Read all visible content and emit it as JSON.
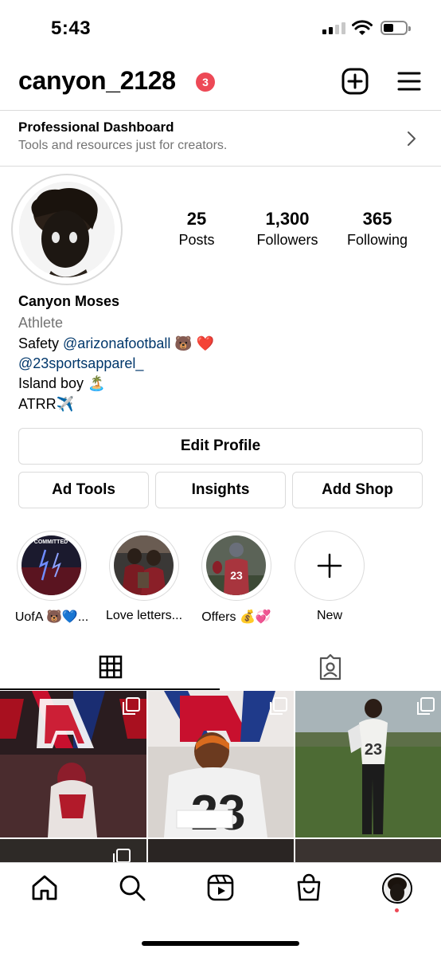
{
  "status_bar": {
    "time": "5:43"
  },
  "header": {
    "username": "canyon_2128",
    "notification_count": "3"
  },
  "dashboard": {
    "title": "Professional Dashboard",
    "subtitle": "Tools and resources just for creators."
  },
  "stats": [
    {
      "value": "25",
      "label": "Posts"
    },
    {
      "value": "1,300",
      "label": "Followers"
    },
    {
      "value": "365",
      "label": "Following"
    }
  ],
  "profile": {
    "name": "Canyon Moses",
    "category": "Athlete",
    "bio": {
      "line1_prefix": "Safety ",
      "line1_mention": "@arizonafootball",
      "line1_emoji": " 🐻 ❤️",
      "line2_mention": "@23sportsapparel_",
      "line3": "Island boy 🏝️",
      "line4": "ATRR✈️"
    }
  },
  "buttons": {
    "edit_profile": "Edit Profile",
    "ad_tools": "Ad Tools",
    "insights": "Insights",
    "add_shop": "Add Shop"
  },
  "highlights": [
    {
      "label": "UofA 🐻💙...",
      "image_text": "COMMITTED"
    },
    {
      "label": "Love letters..."
    },
    {
      "label": "Offers 💰💞"
    },
    {
      "label": "New"
    }
  ],
  "tabs": {
    "active": "grid",
    "items": [
      "grid-icon",
      "tagged-icon"
    ]
  },
  "grid": {
    "post_jersey_number": "23"
  },
  "bottom_nav": [
    "home-icon",
    "search-icon",
    "reels-icon",
    "shop-icon",
    "profile-avatar"
  ],
  "colors": {
    "badge": "#ed4956",
    "link": "#00376b",
    "border": "#dbdbdb",
    "muted": "#737373"
  }
}
